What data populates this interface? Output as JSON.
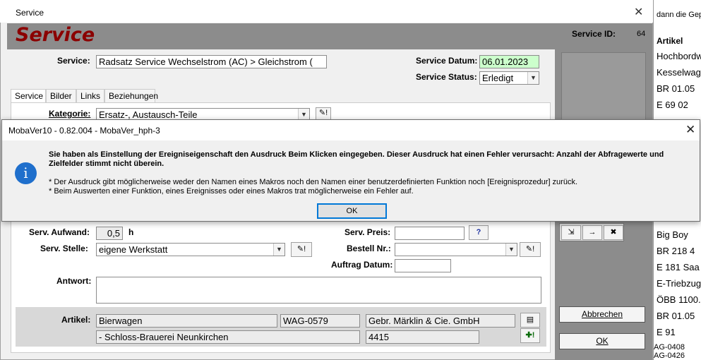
{
  "background_window": {
    "title": "Service",
    "header_title": "Service",
    "service_id_label": "Service ID:",
    "service_id_value": "64",
    "service_label": "Service:",
    "service_value": "Radsatz Service Wechselstrom (AC) > Gleichstrom (",
    "datum_label": "Service Datum:",
    "datum_value": "06.01.2023",
    "status_label": "Service Status:",
    "status_value": "Erledigt",
    "tabs": [
      "Service",
      "Bilder",
      "Links",
      "Beziehungen"
    ],
    "kategorie_label": "Kategorie:",
    "kategorie_value": "Ersatz-, Austausch-Teile",
    "aufwand_label": "Serv. Aufwand:",
    "aufwand_value": "0,5",
    "aufwand_unit": "h",
    "preis_label": "Serv. Preis:",
    "preis_help": "?",
    "stelle_label": "Serv. Stelle:",
    "stelle_value": "eigene Werkstatt",
    "bestell_label": "Bestell Nr.:",
    "auftrag_label": "Auftrag Datum:",
    "antwort_label": "Antwort:",
    "artikel_label": "Artikel:",
    "artikel_name": "Bierwagen",
    "artikel_nr": "WAG-0579",
    "artikel_hersteller": "Gebr. Märklin & Cie. GmbH",
    "artikel_desc": "- Schloss-Brauerei Neunkirchen",
    "artikel_code": "4415",
    "abbrechen_label": "Abbrechen",
    "ok_label": "OK"
  },
  "right_list": {
    "top_text": "dann die Gepla",
    "header": "Artikel",
    "items_top": [
      "Hochbordw",
      "Kesselwag",
      "BR 01.05",
      "E 69 02"
    ],
    "items_bottom": [
      "Big Boy",
      "BR 218 4",
      "E 181 Saa",
      "E-Triebzug",
      "ÖBB 1100.",
      "BR 01.05",
      "E 91"
    ],
    "bottom_codes": [
      "AG-0408",
      "AG-0426"
    ]
  },
  "dialog": {
    "title": "MobaVer10 - 0.82.004 - MobaVer_hph-3",
    "message_main": "Sie haben als Einstellung der Ereigniseigenschaft den Ausdruck Beim Klicken eingegeben. Dieser Ausdruck hat einen Fehler verursacht: Anzahl der Abfragewerte und Zielfelder stimmt nicht überein.",
    "bullet_1": "* Der Ausdruck gibt möglicherweise weder den Namen eines Makros noch den Namen einer benutzerdefinierten Funktion noch [Ereignisprozedur] zurück.",
    "bullet_2": "* Beim Auswerten einer Funktion, eines Ereignisses oder eines Makros trat möglicherweise ein Fehler auf.",
    "ok_label": "OK",
    "icon": "info-icon"
  },
  "colors": {
    "header_bg": "#8c8c8c",
    "header_title": "#8b0000",
    "date_bg": "#ccffcc",
    "dialog_focus": "#0078d7",
    "info_blue": "#1f6fcc"
  }
}
